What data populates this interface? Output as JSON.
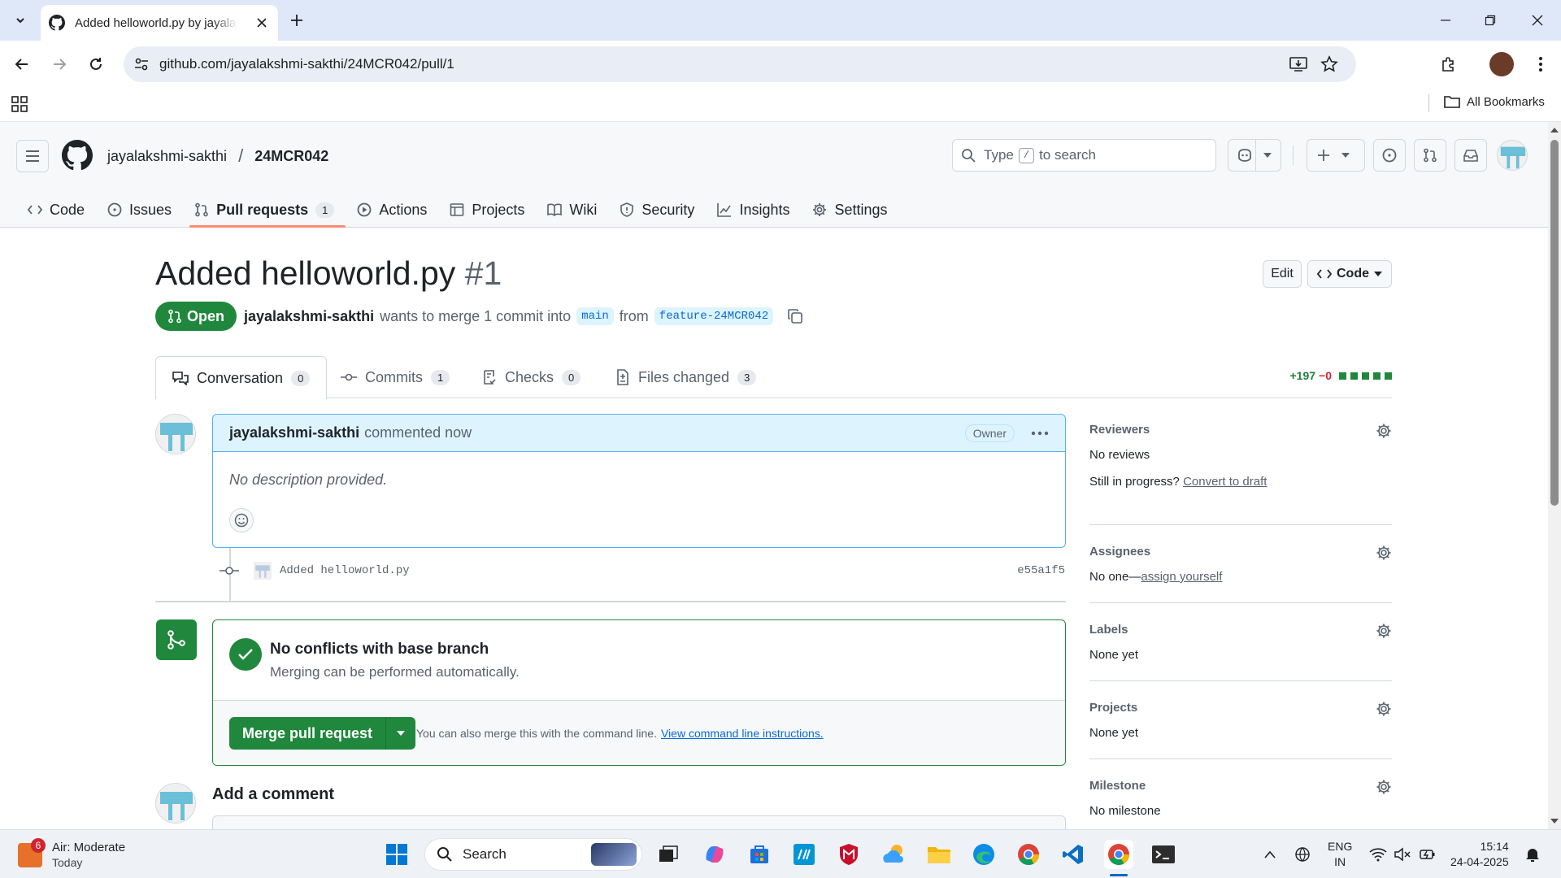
{
  "browser": {
    "tab_title": "Added helloworld.py by jayalakshmi-sakthi",
    "url": "github.com/jayalakshmi-sakthi/24MCR042/pull/1",
    "all_bookmarks": "All Bookmarks"
  },
  "repo": {
    "owner": "jayalakshmi-sakthi",
    "separator": "/",
    "name": "24MCR042",
    "search_prefix": "Type",
    "search_key": "/",
    "search_suffix": "to search"
  },
  "repo_nav": [
    {
      "label": "Code",
      "icon": "code-icon"
    },
    {
      "label": "Issues",
      "icon": "issue-icon"
    },
    {
      "label": "Pull requests",
      "icon": "pull-request-icon",
      "count": "1",
      "active": true
    },
    {
      "label": "Actions",
      "icon": "play-icon"
    },
    {
      "label": "Projects",
      "icon": "table-icon"
    },
    {
      "label": "Wiki",
      "icon": "book-icon"
    },
    {
      "label": "Security",
      "icon": "shield-icon"
    },
    {
      "label": "Insights",
      "icon": "graph-icon"
    },
    {
      "label": "Settings",
      "icon": "gear-icon"
    }
  ],
  "pr": {
    "title": "Added helloworld.py",
    "number": "#1",
    "state": "Open",
    "author": "jayalakshmi-sakthi",
    "merge_text": "wants to merge 1 commit into",
    "base": "main",
    "from_text": "from",
    "head": "feature-24MCR042",
    "edit_label": "Edit",
    "code_label": "Code",
    "additions": "+197",
    "deletions": "−0"
  },
  "pr_tabs": [
    {
      "label": "Conversation",
      "count": "0",
      "active": true
    },
    {
      "label": "Commits",
      "count": "1"
    },
    {
      "label": "Checks",
      "count": "0"
    },
    {
      "label": "Files changed",
      "count": "3"
    }
  ],
  "comment": {
    "author": "jayalakshmi-sakthi",
    "time_text": "commented now",
    "role": "Owner",
    "body": "No description provided."
  },
  "commit": {
    "message": "Added helloworld.py",
    "sha": "e55a1f5"
  },
  "merge": {
    "title": "No conflicts with base branch",
    "subtitle": "Merging can be performed automatically.",
    "button": "Merge pull request",
    "hint": "You can also merge this with the command line.",
    "link": "View command line instructions."
  },
  "add_comment": "Add a comment",
  "sidebar": {
    "reviewers": {
      "heading": "Reviewers",
      "value": "No reviews",
      "progress_text": "Still in progress?",
      "progress_link": "Convert to draft"
    },
    "assignees": {
      "heading": "Assignees",
      "value": "No one—",
      "link": "assign yourself"
    },
    "labels": {
      "heading": "Labels",
      "value": "None yet"
    },
    "projects": {
      "heading": "Projects",
      "value": "None yet"
    },
    "milestone": {
      "heading": "Milestone",
      "value": "No milestone"
    }
  },
  "taskbar": {
    "weather_badge": "6",
    "weather_title": "Air: Moderate",
    "weather_sub": "Today",
    "search": "Search",
    "lang1": "ENG",
    "lang2": "IN",
    "time": "15:14",
    "date": "24-04-2025"
  }
}
